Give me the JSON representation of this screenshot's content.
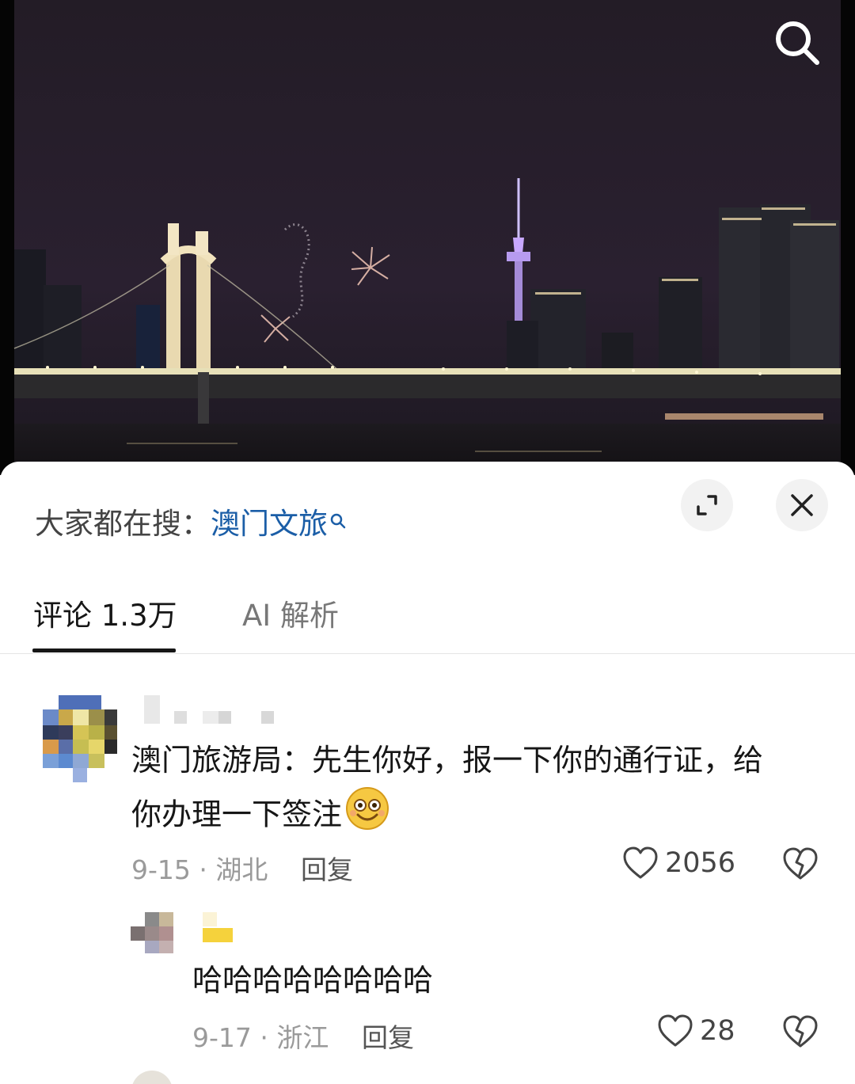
{
  "video": {
    "search_icon": "search-icon"
  },
  "sheet": {
    "hot_search_prefix": "大家都在搜：",
    "hot_search_keyword": "澳门文旅",
    "expand_icon": "expand-icon",
    "close_icon": "close-icon"
  },
  "tabs": [
    {
      "label": "评论 1.3万",
      "active": true
    },
    {
      "label": "AI 解析",
      "active": false
    }
  ],
  "comments": [
    {
      "text_line1": "澳门旅游局：先生你好，报一下你的通行证，给",
      "text_line2": "你办理一下签注",
      "emoji": "smile-emoji",
      "date_location": "9-15 · 湖北",
      "reply_label": "回复",
      "likes": "2056",
      "replies": [
        {
          "text": "哈哈哈哈哈哈哈哈",
          "date_location": "9-17 · 浙江",
          "reply_label": "回复",
          "likes": "28"
        }
      ]
    }
  ],
  "colors": {
    "link_blue": "#1b5ea7",
    "text": "#161616",
    "muted": "#9a9a9a"
  }
}
